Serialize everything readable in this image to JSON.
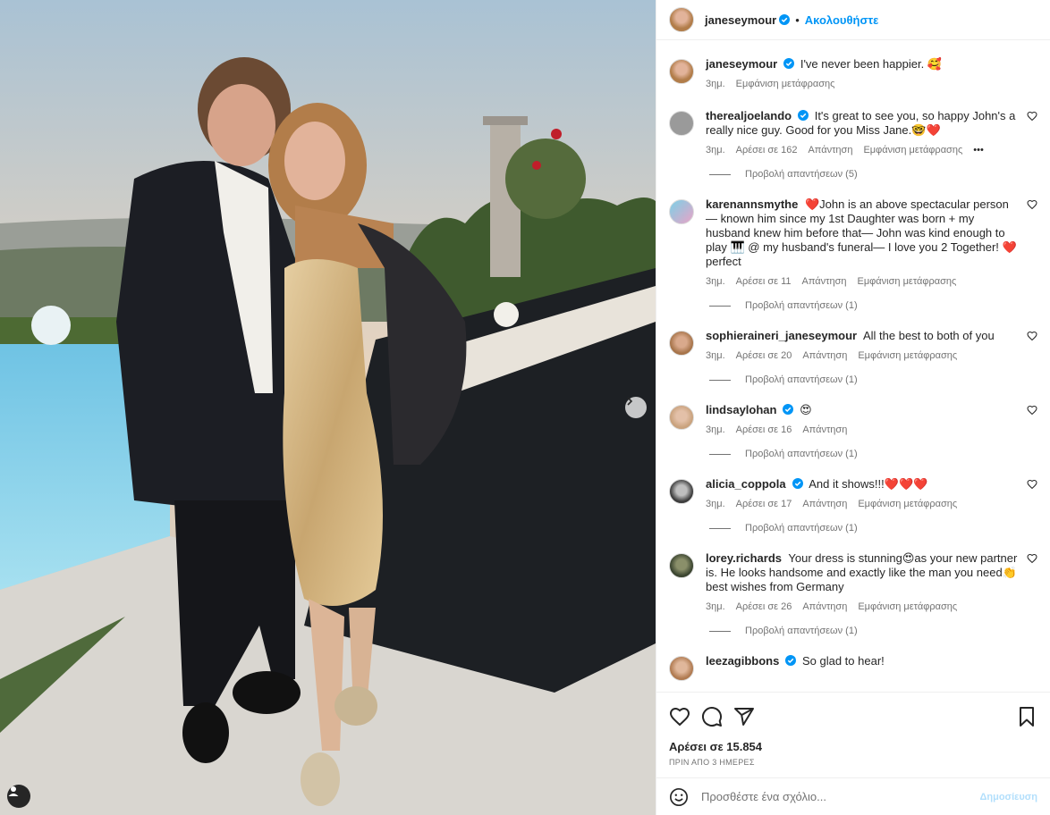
{
  "post": {
    "author": "janeseymour",
    "follow_label": "Ακολουθήστε",
    "dot": "•",
    "likes": "Αρέσει σε 15.854",
    "date": "ΠΡΙΝ ΑΠΟ 3 ΗΜΕΡΕΣ",
    "add_comment_placeholder": "Προσθέστε ένα σχόλιο...",
    "post_label": "Δημοσίευση"
  },
  "caption": {
    "user": "janeseymour",
    "text": "I've never been happier. 🥰",
    "time": "3ημ.",
    "translate": "Εμφάνιση μετάφρασης"
  },
  "comments": [
    {
      "user": "therealjoelando",
      "text": "It's great to see you, so happy John's a really nice guy. Good for you Miss Jane.🤓❤️",
      "time": "3ημ.",
      "likes": "Αρέσει σε 162",
      "reply": "Απάντηση",
      "translate": "Εμφάνιση μετάφρασης",
      "more": "•••",
      "replies": "Προβολή απαντήσεων (5)"
    },
    {
      "user": "karenannsmythe",
      "text": "❤️John is an above spectacular person— known him since my 1st Daughter was born + my husband knew him before that— John was kind enough to play 🎹 @ my husband's funeral— I love you 2 Together! ❤️ perfect",
      "time": "3ημ.",
      "likes": "Αρέσει σε 11",
      "reply": "Απάντηση",
      "translate": "Εμφάνιση μετάφρασης",
      "replies": "Προβολή απαντήσεων (1)"
    },
    {
      "user": "sophieraineri_janeseymour",
      "text": "All the best to both of you",
      "time": "3ημ.",
      "likes": "Αρέσει σε 20",
      "reply": "Απάντηση",
      "translate": "Εμφάνιση μετάφρασης",
      "replies": "Προβολή απαντήσεων (1)"
    },
    {
      "user": "lindsaylohan",
      "text": "😍",
      "time": "3ημ.",
      "likes": "Αρέσει σε 16",
      "reply": "Απάντηση",
      "replies": "Προβολή απαντήσεων (1)"
    },
    {
      "user": "alicia_coppola",
      "text": "And it shows!!!❤️❤️❤️",
      "time": "3ημ.",
      "likes": "Αρέσει σε 17",
      "reply": "Απάντηση",
      "translate": "Εμφάνιση μετάφρασης",
      "replies": "Προβολή απαντήσεων (1)"
    },
    {
      "user": "lorey.richards",
      "text": "Your dress is stunning😍as your new partner is. He looks handsome and exactly like the man you need👏best wishes from Germany",
      "time": "3ημ.",
      "likes": "Αρέσει σε 26",
      "reply": "Απάντηση",
      "translate": "Εμφάνιση μετάφρασης",
      "replies": "Προβολή απαντήσεων (1)"
    },
    {
      "user": "leezagibbons",
      "text": "So glad to hear!"
    }
  ],
  "icons": {
    "like": "heart-icon",
    "comment": "comment-icon",
    "share": "share-icon",
    "save": "bookmark-icon",
    "emoji": "emoji-icon",
    "verified": "verified-badge-icon",
    "next": "chevron-right-icon",
    "tag": "user-tag-icon"
  },
  "colors": {
    "accent": "#0095f6",
    "verified": "#0095f6",
    "post_disabled": "#b2dffc",
    "heart": "#ed1c24"
  }
}
